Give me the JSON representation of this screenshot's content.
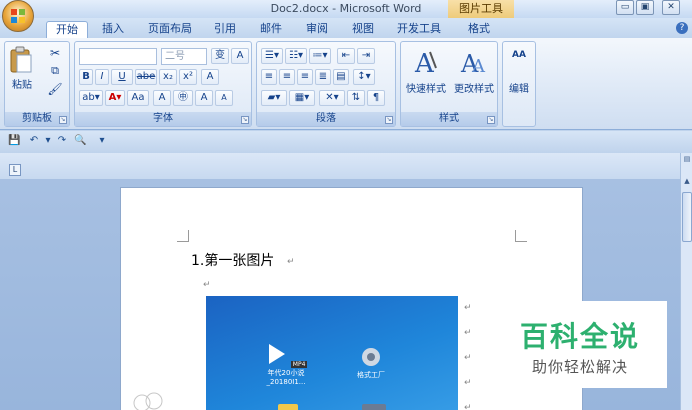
{
  "window": {
    "title": "Doc2.docx - Microsoft Word",
    "contextual_tab": "图片工具",
    "buttons": {
      "minimize": "▭",
      "restore": "▣",
      "close": "✕"
    }
  },
  "tabs": [
    {
      "label": "开始",
      "active": true
    },
    {
      "label": "插入"
    },
    {
      "label": "页面布局"
    },
    {
      "label": "引用"
    },
    {
      "label": "邮件"
    },
    {
      "label": "审阅"
    },
    {
      "label": "视图"
    },
    {
      "label": "开发工具"
    },
    {
      "label": "格式"
    }
  ],
  "ribbon": {
    "clipboard": {
      "label": "剪贴板",
      "paste": "粘贴"
    },
    "font": {
      "label": "字体",
      "font_size_placeholder": "二号",
      "bold": "B",
      "italic": "I",
      "underline": "U",
      "strike": "abe",
      "subscript": "x₂",
      "superscript": "x²",
      "grow": "A",
      "shrink": "A",
      "case": "Aa",
      "char_border": "A",
      "enclosed": "㊥",
      "phonetic": "变",
      "clear": "A"
    },
    "paragraph": {
      "label": "段落"
    },
    "styles": {
      "label": "样式",
      "quick_styles": "快速样式",
      "change_styles": "更改样式"
    },
    "editing": {
      "label": "编辑",
      "find": "AA"
    }
  },
  "document": {
    "heading": "1.第一张图片",
    "para_mark": "↵",
    "image_icons": [
      {
        "name": "MP4",
        "label": "年代20小说",
        "sublabel": "_20180I1..."
      },
      {
        "name": "app",
        "label": "格式工厂"
      }
    ]
  },
  "watermark": {
    "title": "百科全说",
    "subtitle": "助你轻松解决"
  },
  "colors": {
    "accent": "#2db06f",
    "ribbon_text": "#15428b"
  }
}
